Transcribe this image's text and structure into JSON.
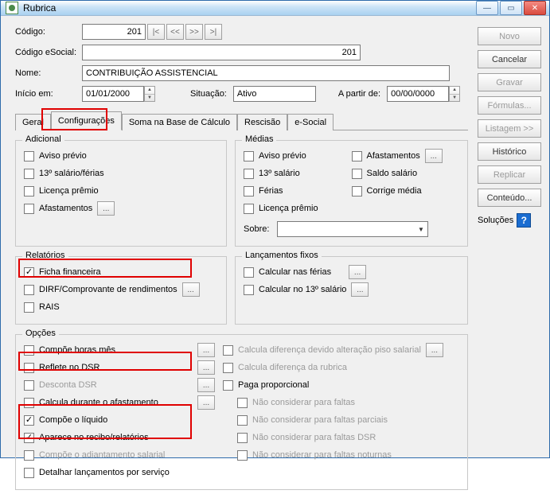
{
  "window": {
    "title": "Rubrica"
  },
  "form": {
    "codigo_label": "Código:",
    "codigo_value": "201",
    "codigo_esocial_label": "Código eSocial:",
    "codigo_esocial_value": "201",
    "nome_label": "Nome:",
    "nome_value": "CONTRIBUIÇÃO ASSISTENCIAL",
    "inicio_em_label": "Início em:",
    "inicio_em_value": "01/01/2000",
    "situacao_label": "Situação:",
    "situacao_value": "Ativo",
    "a_partir_de_label": "A partir de:",
    "a_partir_de_value": "00/00/0000"
  },
  "tabs": {
    "geral": "Geral",
    "configuracoes": "Configurações",
    "soma": "Soma na Base de Cálculo",
    "rescisao": "Rescisão",
    "esocial": "e-Social"
  },
  "adicional": {
    "title": "Adicional",
    "aviso_previo": "Aviso prévio",
    "salario_ferias": "13º salário/férias",
    "licenca_premio": "Licença prêmio",
    "afastamentos": "Afastamentos"
  },
  "medias": {
    "title": "Médias",
    "aviso_previo": "Aviso prévio",
    "afastamentos": "Afastamentos",
    "salario": "13º salário",
    "saldo_salario": "Saldo salário",
    "ferias": "Férias",
    "corrige_media": "Corrige média",
    "licenca_premio": "Licença prêmio",
    "sobre": "Sobre:"
  },
  "relatorios": {
    "title": "Relatórios",
    "ficha_financeira": "Ficha financeira",
    "dirf": "DIRF/Comprovante de rendimentos",
    "rais": "RAIS"
  },
  "lancamentos_fixos": {
    "title": "Lançamentos fixos",
    "calc_ferias": "Calcular nas férias",
    "calc_13": "Calcular no 13º salário"
  },
  "opcoes": {
    "title": "Opções",
    "compoe_horas": "Compõe horas mês",
    "reflete_dsr": "Reflete no DSR",
    "desconta_dsr": "Desconta DSR",
    "calcula_afast": "Calcula durante o afastamento",
    "compoe_liquido": "Compõe o líquido",
    "aparece_recibo": "Aparece no recibo/relatórios",
    "compoe_adiant": "Compõe o adiantamento salarial",
    "detalhar": "Detalhar lançamentos por serviço",
    "calc_dif_piso": "Calcula diferença devido alteração piso salarial",
    "calc_dif_rubrica": "Calcula diferença da rubrica",
    "paga_proporcional": "Paga proporcional",
    "nao_faltas": "Não considerar para faltas",
    "nao_faltas_parciais": "Não considerar para faltas parciais",
    "nao_faltas_dsr": "Não considerar para faltas DSR",
    "nao_faltas_noturnas": "Não considerar para faltas noturnas"
  },
  "buttons": {
    "novo": "Novo",
    "cancelar": "Cancelar",
    "gravar": "Gravar",
    "formulas": "Fórmulas...",
    "listagem": "Listagem >>",
    "historico": "Histórico",
    "replicar": "Replicar",
    "conteudo": "Conteúdo...",
    "solucoes": "Soluções"
  }
}
